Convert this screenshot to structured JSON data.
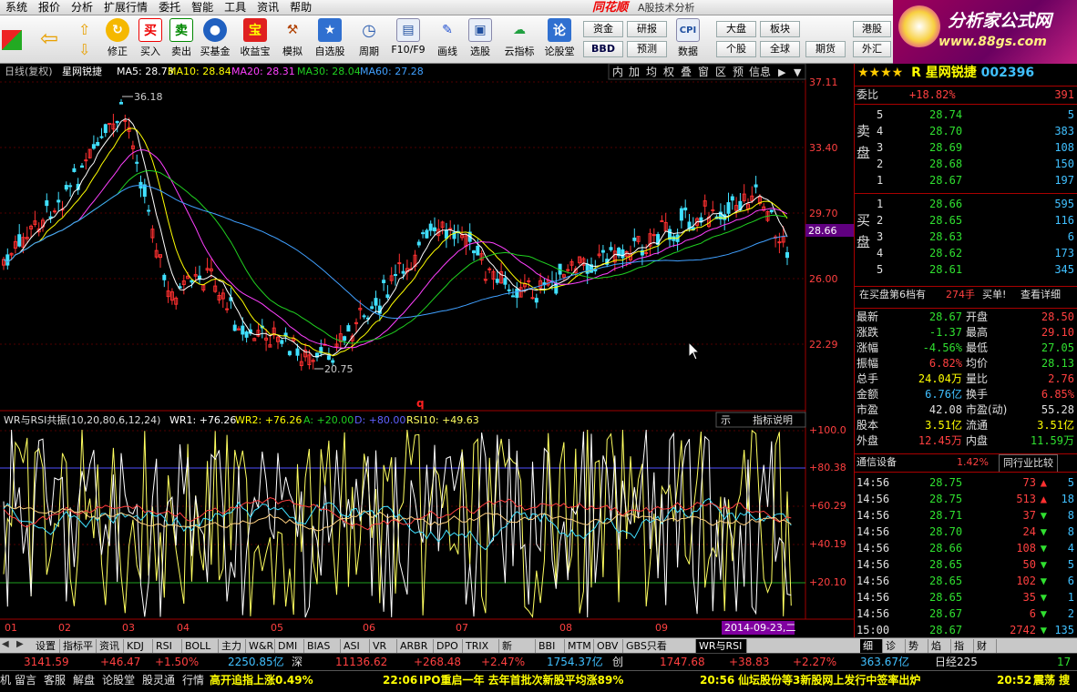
{
  "menu": {
    "items": [
      "系统",
      "报价",
      "分析",
      "扩展行情",
      "委托",
      "智能",
      "工具",
      "资讯",
      "帮助"
    ],
    "brand": "同花顺",
    "subtitle": "A股技术分析"
  },
  "toolbar": {
    "buttons": [
      "修正",
      "买入",
      "卖出",
      "买基金",
      "收益宝",
      "模拟",
      "自选股",
      "周期",
      "F10/F9",
      "画线",
      "选股",
      "云指标",
      "论股堂"
    ],
    "small": [
      "资金",
      "研报",
      "BBD",
      "预测",
      "数据",
      "大盘",
      "板块",
      "个股",
      "全球",
      "期货",
      "港股",
      "外汇"
    ]
  },
  "logo": {
    "title": "分析家公式网",
    "url": "www.88gs.com"
  },
  "main_chart": {
    "legend": {
      "label": "日线(复权)",
      "name": "星网锐捷",
      "ma5": "MA5: 28.73",
      "ma10": "MA10: 28.84",
      "ma20": "MA20: 28.31",
      "ma30": "MA30: 28.04",
      "ma60": "MA60: 27.28"
    },
    "price_labels": [
      "37.11",
      "33.40",
      "29.70",
      "26.00",
      "22.29"
    ],
    "current_price": "28.66",
    "high_mark": "36.18",
    "low_mark": "20.75",
    "side_buttons": [
      "内",
      "加",
      "均",
      "权",
      "叠",
      "窗",
      "区",
      "预",
      "信息"
    ],
    "q_mark": "q"
  },
  "sub_chart": {
    "legend": {
      "name": "WR与RSI共振(10,20,80,6,12,24)",
      "wr1": "WR1: +76.26",
      "wr2": "WR2: +76.26",
      "a": "A: +20.00",
      "d": "D: +80.00",
      "rsi": "RSI10: +49.63"
    },
    "indicator_btn": "指标说明",
    "show_btn": "示",
    "labels": [
      "+100.0",
      "+80.38",
      "+60.29",
      "+40.19",
      "+20.10"
    ]
  },
  "months": [
    "01",
    "02",
    "03",
    "04",
    "05",
    "06",
    "07",
    "08",
    "09"
  ],
  "date_badge": "2014-09-23,二",
  "stock": {
    "stars": "★★★★",
    "r": "R",
    "name": "星网锐捷",
    "code": "002396",
    "weibi_label": "委比",
    "weibi": "+18.82%",
    "weicha": "391",
    "sell_label": "卖盘",
    "buy_label": "买盘",
    "sells": [
      [
        "5",
        "28.74",
        "5"
      ],
      [
        "4",
        "28.70",
        "383"
      ],
      [
        "3",
        "28.69",
        "108"
      ],
      [
        "2",
        "28.68",
        "150"
      ],
      [
        "1",
        "28.67",
        "197"
      ]
    ],
    "buys": [
      [
        "1",
        "28.66",
        "595"
      ],
      [
        "2",
        "28.65",
        "116"
      ],
      [
        "3",
        "28.63",
        "6"
      ],
      [
        "4",
        "28.62",
        "173"
      ],
      [
        "5",
        "28.61",
        "345"
      ]
    ],
    "queue_text": "在买盘第6档有",
    "queue_val": "274手",
    "queue_action": "买单!",
    "queue_detail": "查看详细",
    "quote": [
      [
        "最新",
        "28.67",
        "开盘",
        "28.50"
      ],
      [
        "涨跌",
        "-1.37",
        "最高",
        "29.10"
      ],
      [
        "涨幅",
        "-4.56%",
        "最低",
        "27.05"
      ],
      [
        "振幅",
        "6.82%",
        "均价",
        "28.13"
      ],
      [
        "总手",
        "24.04万",
        "量比",
        "2.76"
      ],
      [
        "金额",
        "6.76亿",
        "换手",
        "6.85%"
      ],
      [
        "市盈",
        "42.08",
        "市盈(动)",
        "55.28"
      ],
      [
        "股本",
        "3.51亿",
        "流通",
        "3.51亿"
      ],
      [
        "外盘",
        "12.45万",
        "内盘",
        "11.59万"
      ]
    ],
    "sector": "通信设备",
    "sector_pct": "1.42%",
    "sector_btn": "同行业比较",
    "ticks": [
      [
        "14:56",
        "28.75",
        "73",
        "5"
      ],
      [
        "14:56",
        "28.75",
        "513",
        "18"
      ],
      [
        "14:56",
        "28.71",
        "37",
        "8"
      ],
      [
        "14:56",
        "28.70",
        "24",
        "8"
      ],
      [
        "14:56",
        "28.66",
        "108",
        "4"
      ],
      [
        "14:56",
        "28.65",
        "50",
        "5"
      ],
      [
        "14:56",
        "28.65",
        "102",
        "6"
      ],
      [
        "14:56",
        "28.65",
        "35",
        "1"
      ],
      [
        "14:56",
        "28.67",
        "6",
        "2"
      ],
      [
        "15:00",
        "28.67",
        "2742",
        "135"
      ]
    ],
    "right_tabs": [
      "细",
      "诊",
      "势",
      "焰",
      "指",
      "财"
    ]
  },
  "bottom_tabs": [
    "设置",
    "指标平台",
    "资讯",
    "KDJ",
    "RSI",
    "BOLL",
    "主力",
    "W&R",
    "DMI",
    "BIAS",
    "ASI",
    "VR",
    "ARBR",
    "DPO",
    "TRIX",
    "新DMA",
    "BBI",
    "MTM",
    "OBV",
    "GBS只看MACD",
    "WR与RSI"
  ],
  "status1": {
    "sh": "3141.59",
    "sh_chg": "+46.47",
    "sh_pct": "+1.50%",
    "sh_amt": "2250.85亿",
    "sz_label": "深",
    "sz": "11136.62",
    "sz_chg": "+268.48",
    "sz_pct": "+2.47%",
    "sz_amt": "1754.37亿",
    "cy_label": "创",
    "cy": "1747.68",
    "cy_chg": "+38.83",
    "cy_pct": "+2.27%",
    "cy_amt": "363.67亿",
    "nk_label": "日经225",
    "nk": "17"
  },
  "status2": {
    "items": [
      "机",
      "留言",
      "客服",
      "解盘",
      "论股堂",
      "股灵通",
      "行情"
    ],
    "news1": "高开追指上涨0.49%",
    "t2": "22:06",
    "news2": "IPO重启一年 去年首批次新股平均涨89%",
    "t3": "20:56",
    "news3": "仙坛股份等3新股网上发行中签率出炉",
    "t4": "20:52",
    "news4": "震荡 搜"
  },
  "colors": {
    "up": "#ff3030",
    "down": "#40e0ff",
    "ma5": "#ffffff",
    "ma10": "#ffff00",
    "ma20": "#ff40ff",
    "ma30": "#20d020",
    "ma60": "#40a0ff"
  }
}
